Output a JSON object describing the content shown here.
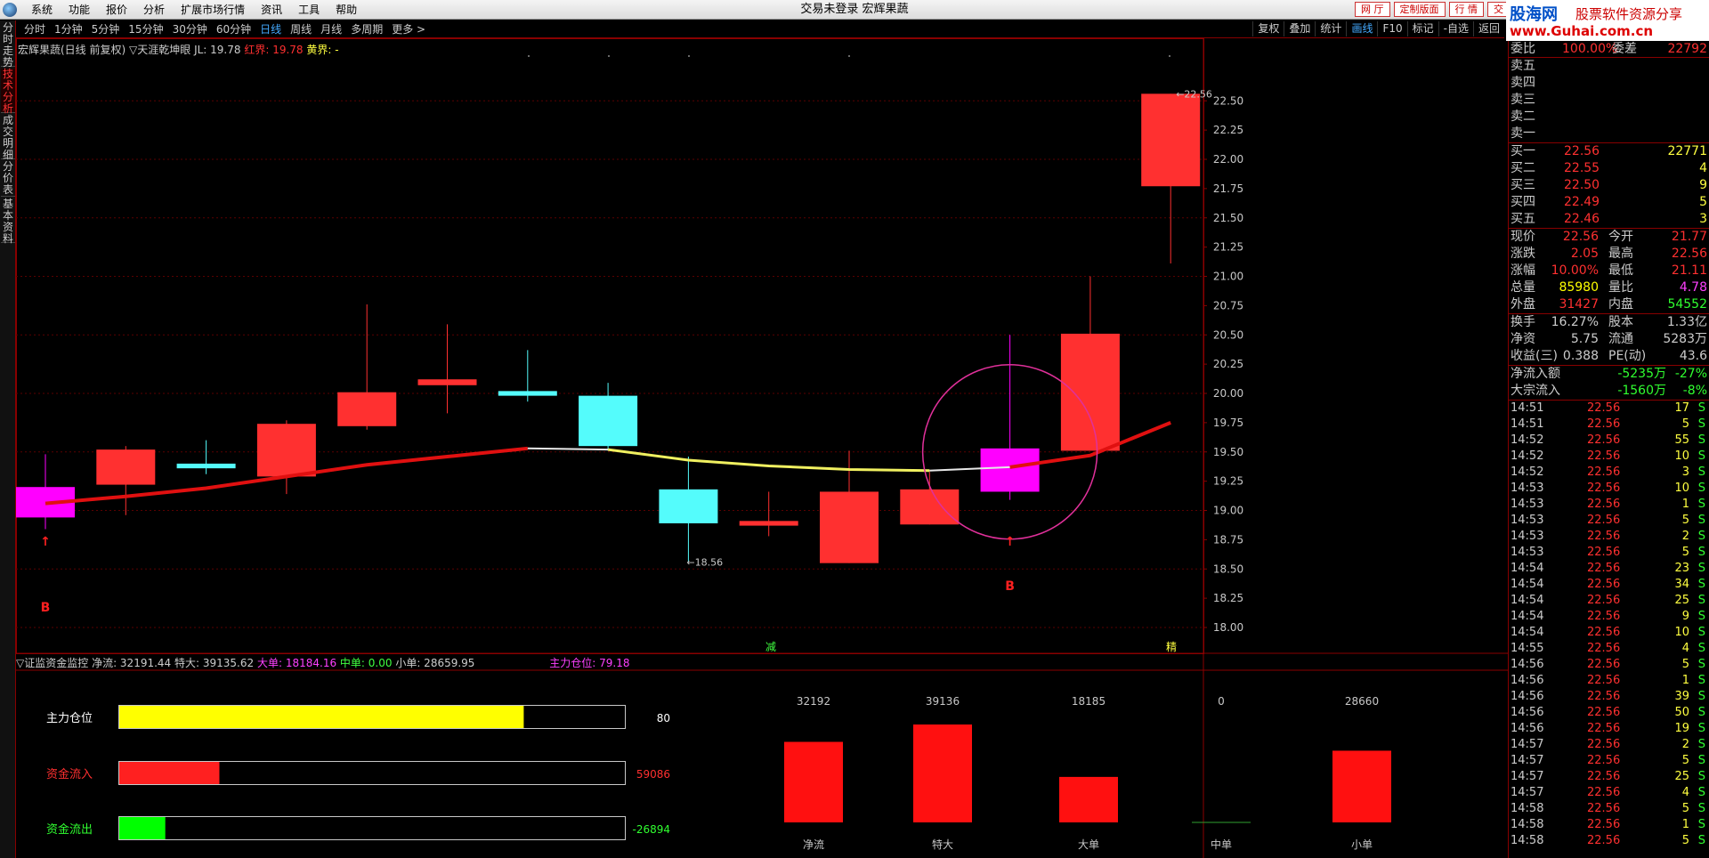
{
  "window": {
    "title": "交易未登录 宏辉果蔬",
    "menu": [
      "系统",
      "功能",
      "报价",
      "分析",
      "扩展市场行情",
      "资讯",
      "工具",
      "帮助"
    ],
    "buttons": [
      "网 厅",
      "定制版面",
      "行 情",
      "交 易"
    ]
  },
  "brand": {
    "line1": "股海网",
    "line2": "股票软件资源分享",
    "line3": "www.Guhai.com.cn"
  },
  "left_tabs": [
    "分时走势",
    "技术分析",
    "成交明细",
    "分价表",
    "基本资料"
  ],
  "periods": [
    "分时",
    "1分钟",
    "5分钟",
    "15分钟",
    "30分钟",
    "60分钟",
    "日线",
    "周线",
    "月线",
    "多周期",
    "更多 >"
  ],
  "active_period": "日线",
  "tools": [
    "复权",
    "叠加",
    "统计",
    "画线",
    "F10",
    "标记",
    "-自选",
    "返回"
  ],
  "active_tool": "画线",
  "main_legend": {
    "stock": "宏辉果蔬(日线 前复权)",
    "indicator": "▽天涯乾坤眼",
    "jl": "JL: 19.78",
    "red": "红界: 19.78",
    "yellow": "黄界: -"
  },
  "chart_data": {
    "type": "candlestick",
    "y_ticks": [
      "22.50",
      "22.25",
      "22.00",
      "21.75",
      "21.50",
      "21.25",
      "21.00",
      "20.75",
      "20.50",
      "20.25",
      "20.00",
      "19.75",
      "19.50",
      "19.25",
      "19.00",
      "18.75",
      "18.50",
      "18.25",
      "18.00"
    ],
    "candles": [
      {
        "open": 19.2,
        "close": 18.94,
        "high": 19.48,
        "low": 18.84,
        "color": "magenta"
      },
      {
        "open": 19.22,
        "close": 19.52,
        "high": 19.55,
        "low": 18.96,
        "color": "red"
      },
      {
        "open": 19.36,
        "close": 19.4,
        "high": 19.6,
        "low": 19.31,
        "color": "cyan"
      },
      {
        "open": 19.29,
        "close": 19.74,
        "high": 19.77,
        "low": 19.14,
        "color": "red"
      },
      {
        "open": 19.72,
        "close": 20.01,
        "high": 20.76,
        "low": 19.69,
        "color": "red"
      },
      {
        "open": 20.07,
        "close": 20.12,
        "high": 20.59,
        "low": 19.83,
        "color": "red"
      },
      {
        "open": 20.02,
        "close": 19.98,
        "high": 20.37,
        "low": 19.93,
        "color": "cyan"
      },
      {
        "open": 19.98,
        "close": 19.55,
        "high": 20.09,
        "low": 19.51,
        "color": "cyan"
      },
      {
        "open": 19.18,
        "close": 18.89,
        "high": 19.46,
        "low": 18.56,
        "color": "cyan"
      },
      {
        "open": 18.87,
        "close": 18.91,
        "high": 19.16,
        "low": 18.78,
        "color": "red"
      },
      {
        "open": 18.55,
        "close": 19.16,
        "high": 19.51,
        "low": 18.55,
        "color": "red"
      },
      {
        "open": 18.88,
        "close": 19.18,
        "high": 19.33,
        "low": 18.88,
        "color": "red"
      },
      {
        "open": 19.53,
        "close": 19.16,
        "high": 20.5,
        "low": 19.09,
        "color": "magenta"
      },
      {
        "open": 19.51,
        "close": 20.51,
        "high": 21.0,
        "low": 19.51,
        "color": "red"
      },
      {
        "open": 21.77,
        "close": 22.56,
        "high": 22.56,
        "low": 21.11,
        "color": "red"
      }
    ],
    "ma_line": [
      19.06,
      19.12,
      19.19,
      19.29,
      19.39,
      19.46,
      19.53,
      19.52,
      19.43,
      19.38,
      19.35,
      19.34,
      19.37,
      19.47,
      19.75
    ],
    "annotations": {
      "high": "22.56",
      "low": "18.56",
      "buy_labels": [
        "B",
        "B"
      ],
      "bottom_marks": [
        "减",
        "精"
      ]
    }
  },
  "sub_legend": {
    "name": "▽证监资金监控",
    "net": "净流: 32191.44",
    "super": "特大: 39135.62",
    "large": "大单: 18184.16",
    "medium": "中单: 0.00",
    "small": "小单: 28659.95",
    "position": "主力仓位: 79.18"
  },
  "fund_bars": [
    {
      "label": "主力仓位",
      "value": "80",
      "fraction": 0.8,
      "color": "#ffff00"
    },
    {
      "label": "资金流入",
      "value": "59086",
      "fraction": 0.198,
      "color": "#ff2020"
    },
    {
      "label": "资金流出",
      "value": "-26894",
      "fraction": 0.091,
      "color": "#00ff00"
    }
  ],
  "flow_columns": {
    "categories": [
      "净流",
      "特大",
      "大单",
      "中单",
      "小单"
    ],
    "value_labels": [
      "32192",
      "39136",
      "18185",
      "0",
      "28660"
    ],
    "values": [
      32192,
      39136,
      18185,
      0,
      28660
    ]
  },
  "quote": {
    "weibi_row": {
      "label": "委比",
      "value": "100.00%",
      "label2": "委差",
      "value2": "22792"
    },
    "sell": [
      {
        "label": "卖五",
        "price": "",
        "vol": ""
      },
      {
        "label": "卖四",
        "price": "",
        "vol": ""
      },
      {
        "label": "卖三",
        "price": "",
        "vol": ""
      },
      {
        "label": "卖二",
        "price": "",
        "vol": ""
      },
      {
        "label": "卖一",
        "price": "",
        "vol": ""
      }
    ],
    "buy": [
      {
        "label": "买一",
        "price": "22.56",
        "vol": "22771"
      },
      {
        "label": "买二",
        "price": "22.55",
        "vol": "4"
      },
      {
        "label": "买三",
        "price": "22.50",
        "vol": "9"
      },
      {
        "label": "买四",
        "price": "22.49",
        "vol": "5"
      },
      {
        "label": "买五",
        "price": "22.46",
        "vol": "3"
      }
    ],
    "stats": [
      {
        "l1": "现价",
        "v1": "22.56",
        "c1": "#ff3030",
        "l2": "今开",
        "v2": "21.77",
        "c2": "#ff3030"
      },
      {
        "l1": "涨跌",
        "v1": "2.05",
        "c1": "#ff3030",
        "l2": "最高",
        "v2": "22.56",
        "c2": "#ff3030"
      },
      {
        "l1": "涨幅",
        "v1": "10.00%",
        "c1": "#ff3030",
        "l2": "最低",
        "v2": "21.11",
        "c2": "#ff3030"
      },
      {
        "l1": "总量",
        "v1": "85980",
        "c1": "#ffff00",
        "l2": "量比",
        "v2": "4.78",
        "c2": "#ff40ff"
      },
      {
        "l1": "外盘",
        "v1": "31427",
        "c1": "#ff3030",
        "l2": "内盘",
        "v2": "54552",
        "c2": "#30ff30"
      }
    ],
    "fundamentals": [
      {
        "l1": "换手",
        "v1": "16.27%",
        "l2": "股本",
        "v2": "1.33亿"
      },
      {
        "l1": "净资",
        "v1": "5.75",
        "l2": "流通",
        "v2": "5283万"
      },
      {
        "l1": "收益(三)",
        "v1": "0.388",
        "l2": "PE(动)",
        "v2": "43.6"
      }
    ],
    "flows": [
      {
        "label": "净流入额",
        "value": "-5235万",
        "pct": "-27%"
      },
      {
        "label": "大宗流入",
        "value": "-1560万",
        "pct": "-8%"
      }
    ],
    "ticks": [
      [
        "14:51",
        "22.56",
        "17",
        "S"
      ],
      [
        "14:51",
        "22.56",
        "5",
        "S"
      ],
      [
        "14:52",
        "22.56",
        "55",
        "S"
      ],
      [
        "14:52",
        "22.56",
        "10",
        "S"
      ],
      [
        "14:52",
        "22.56",
        "3",
        "S"
      ],
      [
        "14:53",
        "22.56",
        "10",
        "S"
      ],
      [
        "14:53",
        "22.56",
        "1",
        "S"
      ],
      [
        "14:53",
        "22.56",
        "5",
        "S"
      ],
      [
        "14:53",
        "22.56",
        "2",
        "S"
      ],
      [
        "14:53",
        "22.56",
        "5",
        "S"
      ],
      [
        "14:54",
        "22.56",
        "23",
        "S"
      ],
      [
        "14:54",
        "22.56",
        "34",
        "S"
      ],
      [
        "14:54",
        "22.56",
        "25",
        "S"
      ],
      [
        "14:54",
        "22.56",
        "9",
        "S"
      ],
      [
        "14:54",
        "22.56",
        "10",
        "S"
      ],
      [
        "14:55",
        "22.56",
        "4",
        "S"
      ],
      [
        "14:56",
        "22.56",
        "5",
        "S"
      ],
      [
        "14:56",
        "22.56",
        "1",
        "S"
      ],
      [
        "14:56",
        "22.56",
        "39",
        "S"
      ],
      [
        "14:56",
        "22.56",
        "50",
        "S"
      ],
      [
        "14:56",
        "22.56",
        "19",
        "S"
      ],
      [
        "14:57",
        "22.56",
        "2",
        "S"
      ],
      [
        "14:57",
        "22.56",
        "5",
        "S"
      ],
      [
        "14:57",
        "22.56",
        "25",
        "S"
      ],
      [
        "14:57",
        "22.56",
        "4",
        "S"
      ],
      [
        "14:58",
        "22.56",
        "5",
        "S"
      ],
      [
        "14:58",
        "22.56",
        "1",
        "S"
      ],
      [
        "14:58",
        "22.56",
        "5",
        "S"
      ]
    ]
  }
}
